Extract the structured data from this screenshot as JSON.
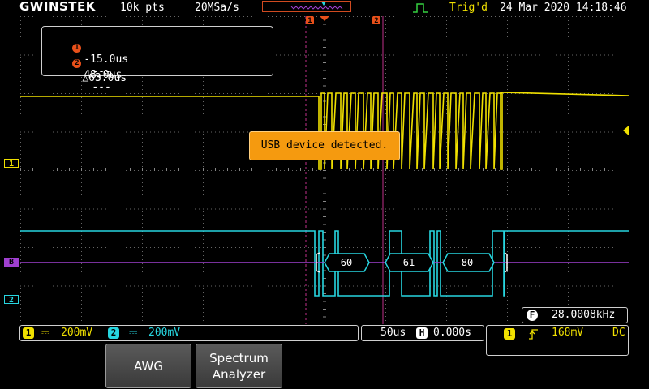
{
  "header": {
    "brand": "GWINSTEK",
    "record_length": "10k pts",
    "sample_rate": "20MSa/s",
    "trigger_status": "Trig'd",
    "datetime": "24 Mar 2020  14:18:46"
  },
  "cursors": {
    "c1_label": "1",
    "c2_label": "2",
    "c1_time": "-15.0us",
    "c1_value": "---",
    "c2_time": "48.0us",
    "c2_value": "---",
    "delta": "△63.0us"
  },
  "popup": {
    "message": "USB device detected."
  },
  "markers": {
    "ch1": "1",
    "bus": "B",
    "ch2": "2"
  },
  "bus_decode": [
    "60",
    "61",
    "80"
  ],
  "frequency": {
    "badge": "F",
    "value": "28.0008kHz"
  },
  "channels": {
    "ch1_badge": "1",
    "ch1_scale": "200mV",
    "ch2_badge": "2",
    "ch2_scale": "200mV"
  },
  "timebase": {
    "scale": "50us",
    "badge": "H",
    "position": "0.000s"
  },
  "trigger": {
    "source": "1",
    "level": "168mV",
    "coupling": "DC"
  },
  "softkeys": {
    "awg": "AWG",
    "spectrum": "Spectrum\nAnalyzer"
  },
  "colors": {
    "ch1": "#f0e000",
    "ch2": "#27d6e0",
    "bus": "#a040d0",
    "cursor": "#e8501a",
    "popup": "#f59a0f"
  }
}
